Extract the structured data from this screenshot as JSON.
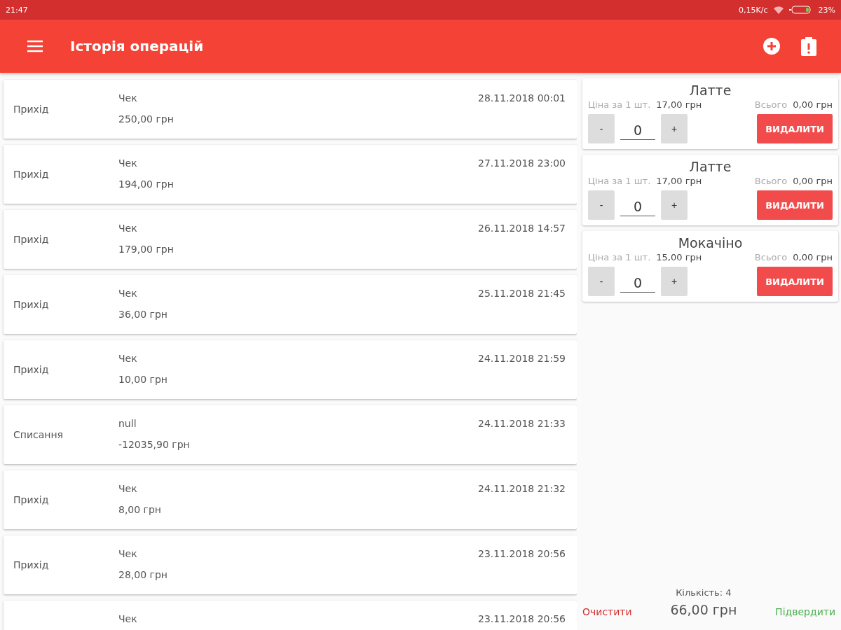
{
  "status_bar": {
    "time": "21:47",
    "speed": "0,15K/c",
    "battery": "23%"
  },
  "app_bar": {
    "title": "Історія операцій"
  },
  "operations": [
    {
      "type": "Прихід",
      "title": "Чек",
      "amount": "250,00 грн",
      "date": "28.11.2018 00:01"
    },
    {
      "type": "Прихід",
      "title": "Чек",
      "amount": "194,00 грн",
      "date": "27.11.2018 23:00"
    },
    {
      "type": "Прихід",
      "title": "Чек",
      "amount": "179,00 грн",
      "date": "26.11.2018 14:57"
    },
    {
      "type": "Прихід",
      "title": "Чек",
      "amount": "36,00 грн",
      "date": "25.11.2018 21:45"
    },
    {
      "type": "Прихід",
      "title": "Чек",
      "amount": "10,00 грн",
      "date": "24.11.2018 21:59"
    },
    {
      "type": "Списання",
      "title": "null",
      "amount": "-12035,90 грн",
      "date": "24.11.2018 21:33"
    },
    {
      "type": "Прихід",
      "title": "Чек",
      "amount": "8,00 грн",
      "date": "24.11.2018 21:32"
    },
    {
      "type": "Прихід",
      "title": "Чек",
      "amount": "28,00 грн",
      "date": "23.11.2018 20:56"
    },
    {
      "title": "Чек",
      "date": "23.11.2018 20:56"
    }
  ],
  "cart": {
    "items": [
      {
        "name": "Латте",
        "price_label": "Ціна за 1 шт.",
        "price": "17,00 грн",
        "total_label": "Всього",
        "total": "0,00 грн",
        "minus": "-",
        "qty": "0",
        "plus": "+",
        "delete": "ВИДАЛИТИ"
      },
      {
        "name": "Латте",
        "price_label": "Ціна за 1 шт.",
        "price": "17,00 грн",
        "total_label": "Всього",
        "total": "0,00 грн",
        "minus": "-",
        "qty": "0",
        "plus": "+",
        "delete": "ВИДАЛИТИ"
      },
      {
        "name": "Мокачіно",
        "price_label": "Ціна за 1 шт.",
        "price": "15,00 грн",
        "total_label": "Всього",
        "total": "0,00 грн",
        "minus": "-",
        "qty": "0",
        "plus": "+",
        "delete": "ВИДАЛИТИ"
      }
    ],
    "clear": "Очистити",
    "count": "Кількість: 4",
    "sum": "66,00 грн",
    "confirm": "Підвердити"
  }
}
